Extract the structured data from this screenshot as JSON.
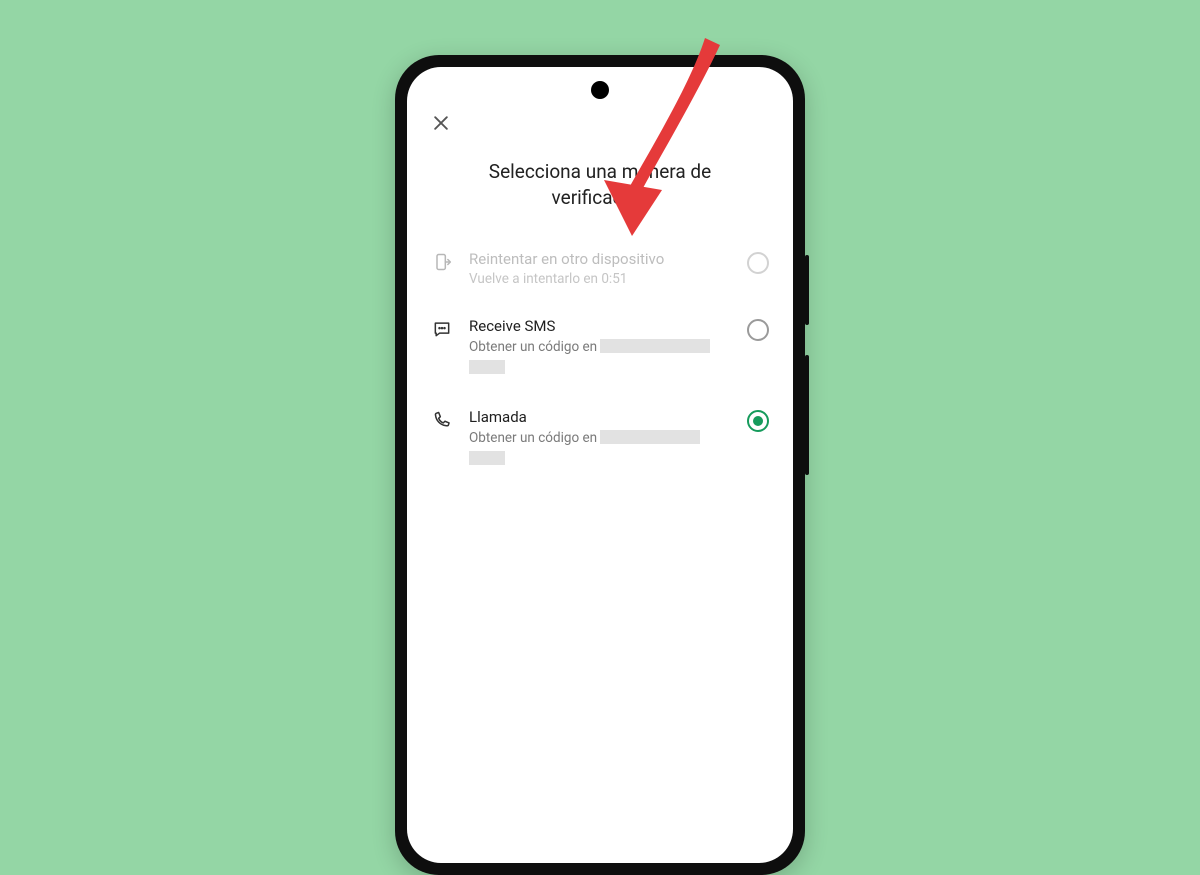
{
  "title_line1": "Selecciona una manera de",
  "title_line2": "verificación",
  "options": {
    "retry": {
      "title": "Reintentar en otro dispositivo",
      "subtitle": "Vuelve a intentarlo en 0:51"
    },
    "sms": {
      "title": "Receive SMS",
      "sub_prefix": "Obtener un código en "
    },
    "call": {
      "title": "Llamada",
      "sub_prefix": "Obtener un código en "
    }
  },
  "colors": {
    "accent": "#169b5c",
    "annotation": "#e53a3a"
  }
}
